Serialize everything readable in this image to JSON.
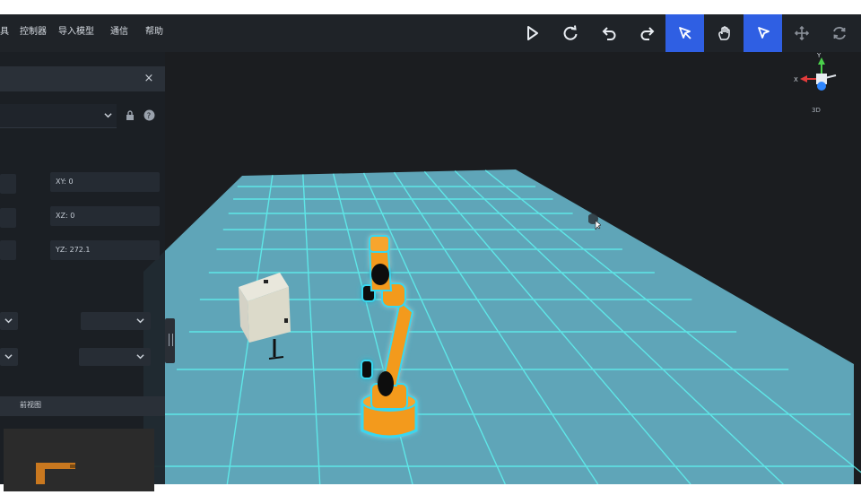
{
  "menu": {
    "items": [
      {
        "label": "具"
      },
      {
        "label": "控制器"
      },
      {
        "label": "导入模型"
      },
      {
        "label": "通信"
      },
      {
        "label": "帮助"
      }
    ]
  },
  "toolbar": {
    "buttons": [
      {
        "icon": "play-icon",
        "active": false
      },
      {
        "icon": "refresh-icon",
        "active": false
      },
      {
        "icon": "undo-icon",
        "active": false
      },
      {
        "icon": "redo-icon",
        "active": false
      },
      {
        "icon": "ai-drag-icon",
        "active": true
      },
      {
        "icon": "hand-teach-icon",
        "active": false
      },
      {
        "icon": "select-pointer-icon",
        "active": true
      },
      {
        "icon": "move-arrows-icon",
        "active": false
      },
      {
        "icon": "rotate-icon",
        "active": false
      }
    ]
  },
  "panel": {
    "close_glyph": "×",
    "fields": {
      "xy": "XY:  0",
      "xz": "XZ:  0",
      "yz": "YZ:  272.1"
    },
    "view_label": "前视图"
  },
  "gizmo": {
    "axis_y": "Y",
    "axis_x": "X",
    "mode": "3D"
  },
  "colors": {
    "toolbar_bg": "#1f2328",
    "active_button": "#2f5fe3",
    "floor": "#5fa5b8",
    "grid_line": "#5ff2f0",
    "robot": "#f39a1f",
    "robot_glow": "#37d7f0"
  }
}
